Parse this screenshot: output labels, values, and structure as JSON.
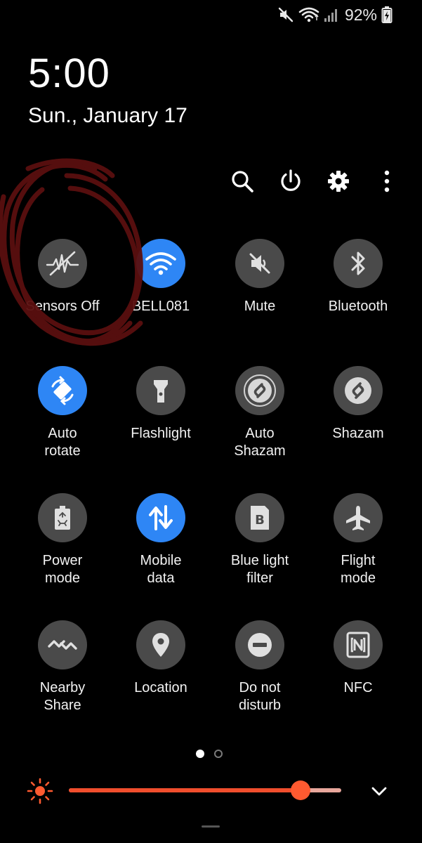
{
  "status_bar": {
    "battery_percent": "92%",
    "icons": [
      "mute-icon",
      "wifi-icon",
      "signal-icon",
      "battery-charging-icon"
    ]
  },
  "clock": {
    "time": "5:00",
    "date": "Sun., January 17"
  },
  "top_actions": [
    "search-icon",
    "power-icon",
    "settings-gear-icon",
    "more-vert-icon"
  ],
  "tiles": [
    {
      "label": "Sensors Off",
      "icon": "sensors-off-icon",
      "active": false
    },
    {
      "label": "BELL081",
      "icon": "wifi-icon",
      "active": true
    },
    {
      "label": "Mute",
      "icon": "mute-icon",
      "active": false
    },
    {
      "label": "Bluetooth",
      "icon": "bluetooth-icon",
      "active": false
    },
    {
      "label": "Auto\nrotate",
      "icon": "auto-rotate-icon",
      "active": true
    },
    {
      "label": "Flashlight",
      "icon": "flashlight-icon",
      "active": false
    },
    {
      "label": "Auto\nShazam",
      "icon": "auto-shazam-icon",
      "active": false
    },
    {
      "label": "Shazam",
      "icon": "shazam-icon",
      "active": false
    },
    {
      "label": "Power\nmode",
      "icon": "power-mode-icon",
      "active": false
    },
    {
      "label": "Mobile\ndata",
      "icon": "mobile-data-icon",
      "active": true
    },
    {
      "label": "Blue light\nfilter",
      "icon": "blue-light-filter-icon",
      "active": false
    },
    {
      "label": "Flight\nmode",
      "icon": "airplane-icon",
      "active": false
    },
    {
      "label": "Nearby\nShare",
      "icon": "nearby-share-icon",
      "active": false
    },
    {
      "label": "Location",
      "icon": "location-pin-icon",
      "active": false
    },
    {
      "label": "Do not\ndisturb",
      "icon": "do-not-disturb-icon",
      "active": false
    },
    {
      "label": "NFC",
      "icon": "nfc-icon",
      "active": false
    }
  ],
  "pages": {
    "current": 1,
    "total": 2
  },
  "brightness": {
    "level": 0.85,
    "icon": "sun-icon"
  },
  "colors": {
    "tile_off": "#4a4a4a",
    "tile_on": "#2e86f5",
    "brightness_accent": "#f04e2d",
    "annotation": "#5a0f0f"
  }
}
